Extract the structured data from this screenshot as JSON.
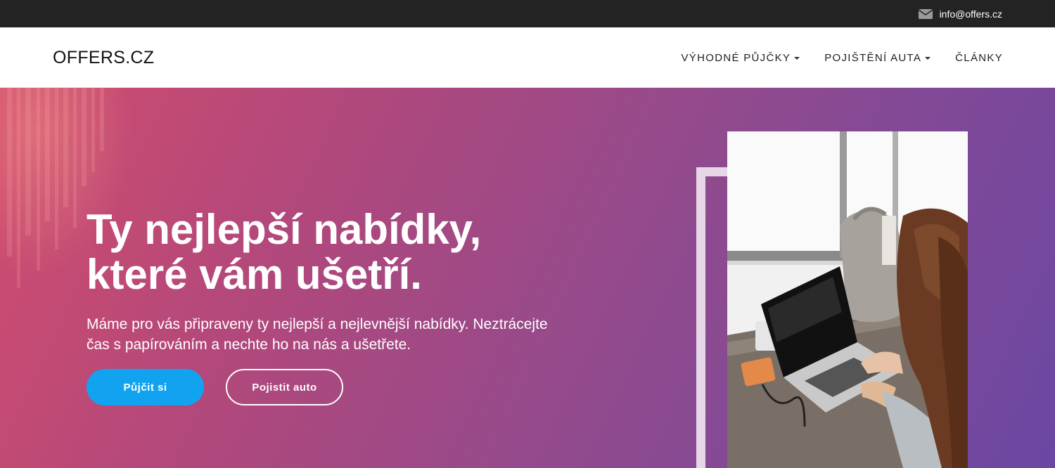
{
  "topbar": {
    "email": "info@offers.cz",
    "icon": "envelope-icon"
  },
  "navbar": {
    "logo": "OFFERS.CZ",
    "items": [
      {
        "label": "VÝHODNÉ PŮJČKY",
        "dropdown": true
      },
      {
        "label": "POJIŠTĚNÍ AUTA",
        "dropdown": true
      },
      {
        "label": "ČLÁNKY",
        "dropdown": false
      }
    ]
  },
  "hero": {
    "title_line1": "Ty nejlepší nabídky,",
    "title_line2": "které vám ušetří.",
    "subtitle_line1": "Máme pro vás připraveny ty nejlepší a nejlevnější nabídky. Neztrácejte",
    "subtitle_line2": "čas s papírováním a nechte ho na nás a ušetřete.",
    "primary_button": "Půjčit si",
    "secondary_button": "Pojistit auto",
    "image_icon": "woman-laptop-photo"
  },
  "colors": {
    "topbar_bg": "#232323",
    "gradient_start": "#d14c6e",
    "gradient_end": "#6b47a3",
    "primary_button": "#11a3ef"
  }
}
